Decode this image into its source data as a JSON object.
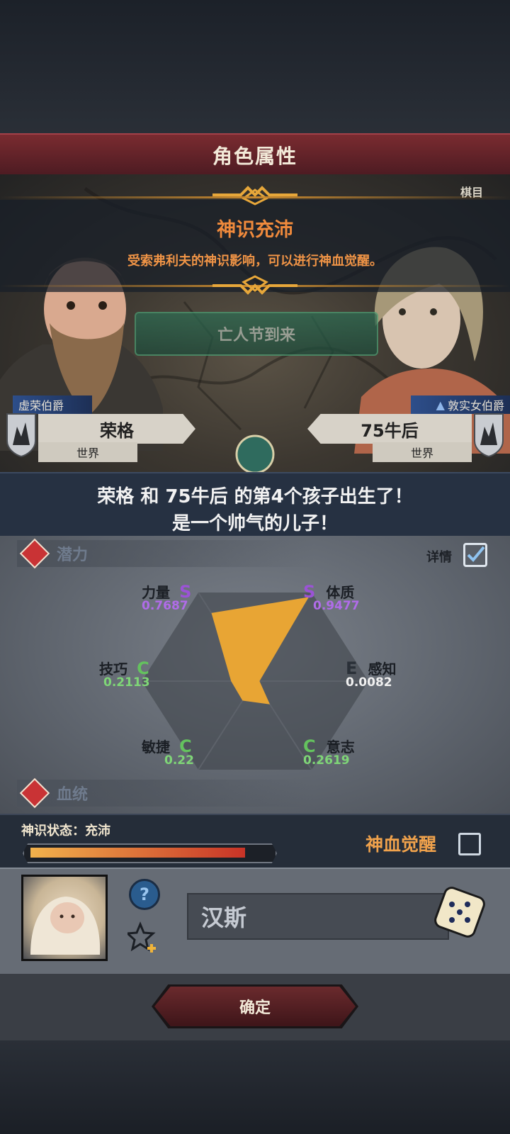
{
  "header": {
    "title": "角色属性"
  },
  "scene": {
    "corner_label": "棋目",
    "banner_title": "神识充沛",
    "banner_subtitle": "受索弗利夫的神识影响，可以进行神血觉醒。",
    "event_button": "亡人节到来",
    "left_character": {
      "title": "虚荣伯爵",
      "name": "荣格",
      "world": "世界"
    },
    "right_character": {
      "title": "敦实女伯爵",
      "name": "75牛后",
      "world": "世界"
    }
  },
  "announcement": {
    "line1": "荣格 和 75牛后 的第4个孩子出生了！",
    "line2": "是一个帅气的儿子！"
  },
  "potential": {
    "section_title": "潜力",
    "detail_label": "详情",
    "detail_checked": true,
    "stats": [
      {
        "name": "力量",
        "grade": "S",
        "value": "0.7687"
      },
      {
        "name": "体质",
        "grade": "S",
        "value": "0.9477"
      },
      {
        "name": "感知",
        "grade": "E",
        "value": "0.0082"
      },
      {
        "name": "意志",
        "grade": "C",
        "value": "0.2619"
      },
      {
        "name": "敏捷",
        "grade": "C",
        "value": "0.22"
      },
      {
        "name": "技巧",
        "grade": "C",
        "value": "0.2113"
      }
    ],
    "radar_values": [
      0.7687,
      0.9477,
      0.0082,
      0.2619,
      0.22,
      0.2113
    ],
    "colors": {
      "S": "#9b53d6",
      "E": "#2a3038",
      "C": "#64c25e",
      "fill": "#e8a534"
    }
  },
  "bloodline": {
    "section_title": "血统"
  },
  "status": {
    "label": "神识状态：充沛",
    "fill_fraction": 0.91,
    "awaken_label": "神血觉醒",
    "awaken_checked": false
  },
  "child": {
    "name": "汉斯",
    "help_icon": "?"
  },
  "confirm": {
    "label": "确定"
  }
}
